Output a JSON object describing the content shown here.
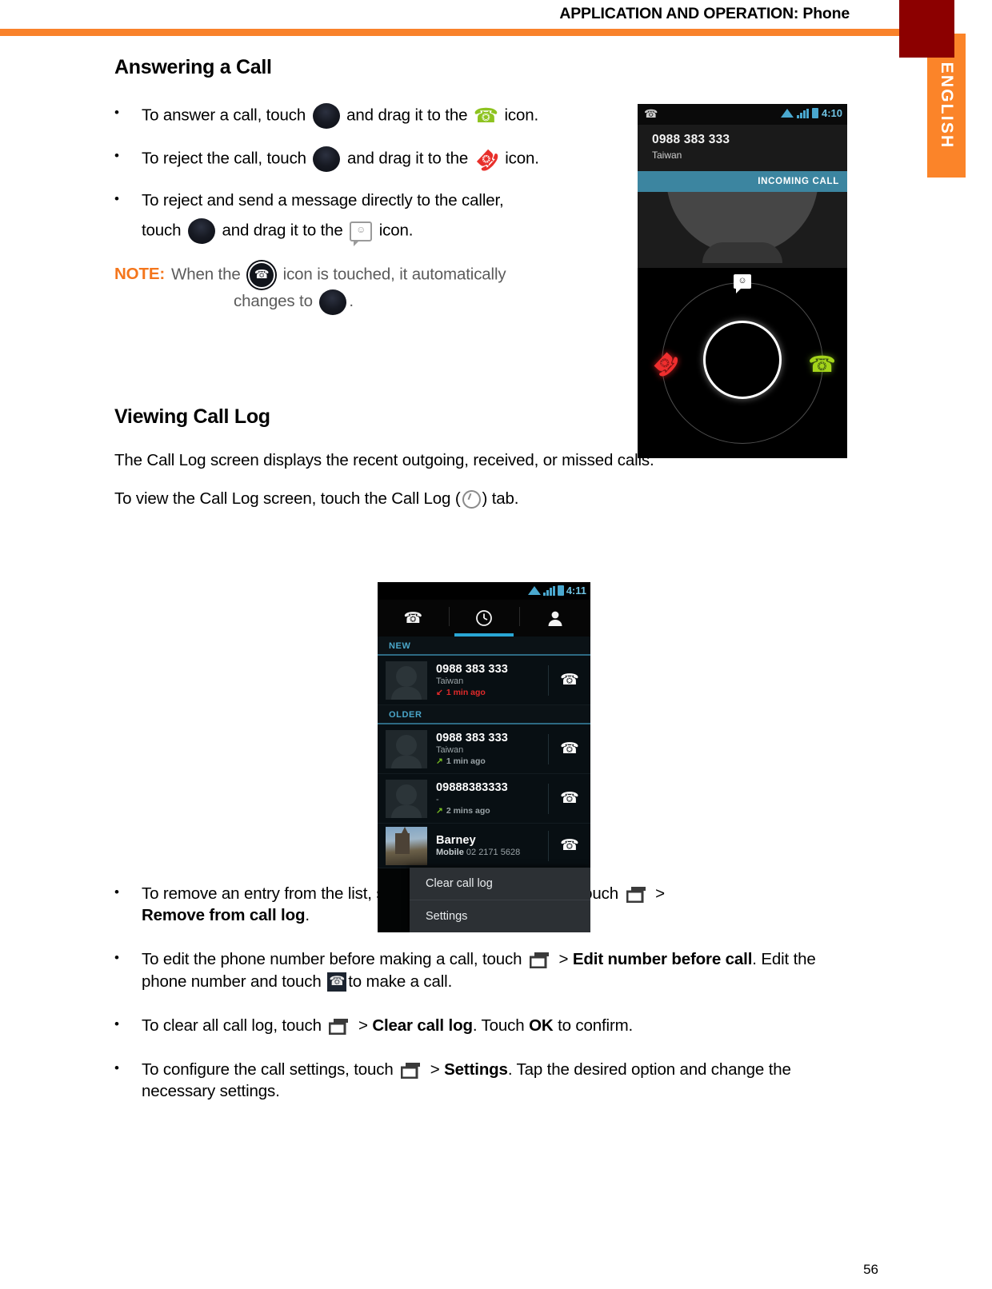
{
  "header": {
    "title": "APPLICATION AND OPERATION: Phone",
    "language_tab": "ENGLISH"
  },
  "page_number": "56",
  "sections": [
    {
      "id": "answering-a-call",
      "title": "Answering a Call"
    },
    {
      "id": "viewing-call-log",
      "title": "Viewing Call Log"
    }
  ],
  "answering": {
    "title": "Answering a Call",
    "bullets": [
      {
        "bullet": "•",
        "part1": "To answer a call, touch",
        "icon1": "drag-handle-icon",
        "part2": "and drag it to the",
        "icon2": "phone-green-icon",
        "part3": "icon."
      },
      {
        "bullet": "•",
        "part1": "To reject the call, touch",
        "icon1": "drag-handle-icon",
        "part2": "and drag it to the",
        "icon2": "phone-hangup-red-icon",
        "part3": "icon."
      },
      {
        "bullet": "•",
        "part1": "To reject and send a message directly to the caller,",
        "part1b": "touch",
        "icon1": "drag-handle-icon",
        "part2": "and drag it to the",
        "icon2": "message-bubble-icon",
        "part3": "icon."
      }
    ],
    "note": {
      "label": "NOTE:",
      "text1": "When the",
      "icon1": "phone-circle-icon",
      "text2": "icon is touched, it automatically",
      "text3": "changes to",
      "icon2": "drag-handle-icon",
      "text4": "."
    }
  },
  "viewing": {
    "title": "Viewing Call Log",
    "paragraph1": "The Call Log screen displays the recent outgoing, received, or missed calls.",
    "paragraph2_a": "To view the Call Log screen, touch the Call Log (",
    "paragraph2_icon": "clock-icon",
    "paragraph2_b": ") tab.",
    "bullets": [
      {
        "bullet": "•",
        "part1": "To remove an entry from the list, select the desired entry and touch",
        "icon1": "menu-overflow-icon",
        "sep": ">",
        "bold1": "Remove from call log",
        "part2": "."
      },
      {
        "bullet": "•",
        "part1": "To edit the phone number before making a call, touch",
        "icon1": "menu-overflow-icon",
        "sep": ">",
        "bold1": "Edit number before call",
        "part2": ". Edit the phone number and touch",
        "icon2": "phone-dark-icon",
        "part3": "to make a call."
      },
      {
        "bullet": "•",
        "part1": "To clear all call log, touch",
        "icon1": "menu-overflow-icon",
        "sep": ">",
        "bold1": "Clear call log",
        "part2": ". Touch",
        "bold2": "OK",
        "part3": "to confirm."
      },
      {
        "bullet": "•",
        "part1": "To configure the call settings, touch",
        "icon1": "menu-overflow-icon",
        "sep": ">",
        "bold1": "Settings",
        "part2": ". Tap the desired option and change the necessary settings."
      }
    ]
  },
  "incoming_call_screen": {
    "status_bar": {
      "left_icon": "phone-icon",
      "wifi_icon": "wifi-icon",
      "signal_icon": "signal-bars-icon",
      "battery_icon": "battery-icon",
      "time": "4:10"
    },
    "caller_number": "0988 383 333",
    "caller_region": "Taiwan",
    "banner": "INCOMING CALL",
    "message_icon": "message-bubble-icon",
    "reject_icon": "phone-hangup-red-icon",
    "accept_icon": "phone-green-icon"
  },
  "call_log_screen": {
    "status_bar": {
      "wifi_icon": "wifi-icon",
      "signal_icon": "signal-bars-icon",
      "battery_icon": "battery-icon",
      "time": "4:11"
    },
    "tabs": [
      {
        "icon": "phone-icon",
        "glyph": "✆",
        "active": false
      },
      {
        "icon": "clock-icon",
        "glyph": "◷",
        "active": true
      },
      {
        "icon": "contacts-icon",
        "glyph": "●",
        "active": false
      }
    ],
    "groups": [
      {
        "label": "NEW",
        "rows": [
          {
            "name": "0988 383 333",
            "sub": "Taiwan",
            "sub_bold": "",
            "direction": "incoming-missed",
            "arrow": "↙",
            "time": "1 min ago",
            "avatar": "placeholder",
            "call_button": "phone-icon"
          }
        ]
      },
      {
        "label": "OLDER",
        "rows": [
          {
            "name": "0988 383 333",
            "sub": "Taiwan",
            "sub_bold": "",
            "direction": "outgoing",
            "arrow": "↗",
            "time": "1 min ago",
            "avatar": "placeholder",
            "call_button": "phone-icon"
          },
          {
            "name": "09888383333",
            "sub": "-",
            "sub_bold": "",
            "direction": "outgoing",
            "arrow": "↗",
            "time": "2 mins ago",
            "avatar": "placeholder",
            "call_button": "phone-icon"
          },
          {
            "name": "Barney",
            "sub": " 02 2171 5628",
            "sub_bold": "Mobile",
            "direction": "",
            "arrow": "",
            "time": "",
            "avatar": "photo",
            "call_button": "phone-icon"
          }
        ]
      }
    ],
    "context_menu": [
      "Clear call log",
      "Settings"
    ]
  },
  "colors": {
    "accent_orange": "#f9822b",
    "note_orange": "#f4761c",
    "dark_red": "#8c0000",
    "android_blue": "#29a7d6",
    "missed_red": "#e02a2a",
    "outgoing_green": "#76bd20"
  }
}
